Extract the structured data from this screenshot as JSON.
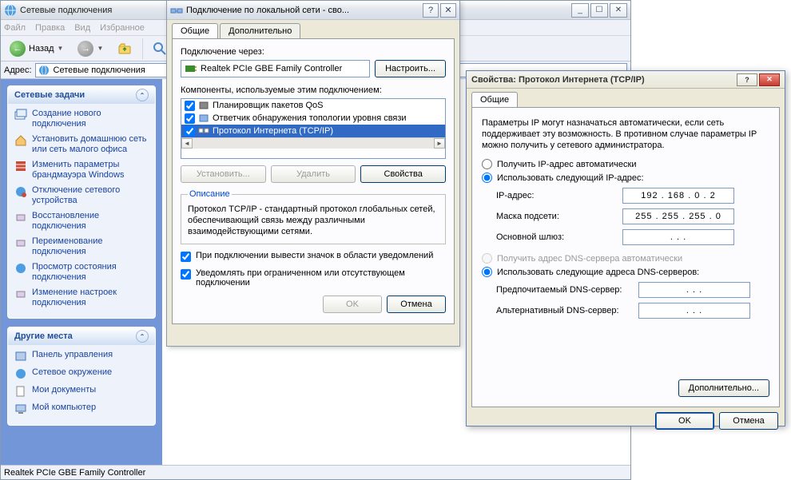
{
  "mainw": {
    "title": "Сетевые подключения",
    "menu": [
      "Файл",
      "Правка",
      "Вид",
      "Избранное"
    ],
    "back": "Назад",
    "address_label": "Адрес:",
    "address_value": "Сетевые подключения"
  },
  "sidebar": {
    "tasks_title": "Сетевые задачи",
    "tasks": [
      "Создание нового подключения",
      "Установить домашнюю сеть или сеть малого офиса",
      "Изменить параметры брандмауэра Windows",
      "Отключение сетевого устройства",
      "Восстановление подключения",
      "Переименование подключения",
      "Просмотр состояния подключения",
      "Изменение настроек подключения"
    ],
    "places_title": "Другие места",
    "places": [
      "Панель управления",
      "Сетевое окружение",
      "Мои документы",
      "Мой компьютер"
    ]
  },
  "statusbar": "Realtek PCIe GBE Family Controller",
  "dlg1": {
    "title": "Подключение по локальной сети - сво...",
    "tab_general": "Общие",
    "tab_advanced": "Дополнительно",
    "connect_via": "Подключение через:",
    "adapter": "Realtek PCIe GBE Family Controller",
    "configure": "Настроить...",
    "components_label": "Компоненты, используемые этим подключением:",
    "components": [
      "Планировщик пакетов QoS",
      "Ответчик обнаружения топологии уровня связи",
      "Протокол Интернета (TCP/IP)"
    ],
    "install": "Установить...",
    "uninstall": "Удалить",
    "properties": "Свойства",
    "desc_legend": "Описание",
    "desc_text": "Протокол TCP/IP - стандартный протокол глобальных сетей, обеспечивающий связь между различными взаимодействующими сетями.",
    "chk1": "При подключении вывести значок в области уведомлений",
    "chk2": "Уведомлять при ограниченном или отсутствующем подключении",
    "ok": "OK",
    "cancel": "Отмена"
  },
  "dlg2": {
    "title": "Свойства: Протокол Интернета (TCP/IP)",
    "tab_general": "Общие",
    "info": "Параметры IP могут назначаться автоматически, если сеть поддерживает эту возможность. В противном случае параметры IP можно получить у сетевого администратора.",
    "r_auto": "Получить IP-адрес автоматически",
    "r_manual": "Использовать следующий IP-адрес:",
    "ip_label": "IP-адрес:",
    "ip_value": "192 . 168 .   0   .   2",
    "mask_label": "Маска подсети:",
    "mask_value": "255 . 255 . 255 .   0",
    "gateway_label": "Основной шлюз:",
    "gateway_value": ".         .         .",
    "dns_auto": "Получить адрес DNS-сервера автоматически",
    "dns_manual": "Использовать следующие адреса DNS-серверов:",
    "dns1_label": "Предпочитаемый DNS-сервер:",
    "dns1_value": ".         .         .",
    "dns2_label": "Альтернативный DNS-сервер:",
    "dns2_value": ".         .         .",
    "advanced": "Дополнительно...",
    "ok": "OK",
    "cancel": "Отмена"
  }
}
